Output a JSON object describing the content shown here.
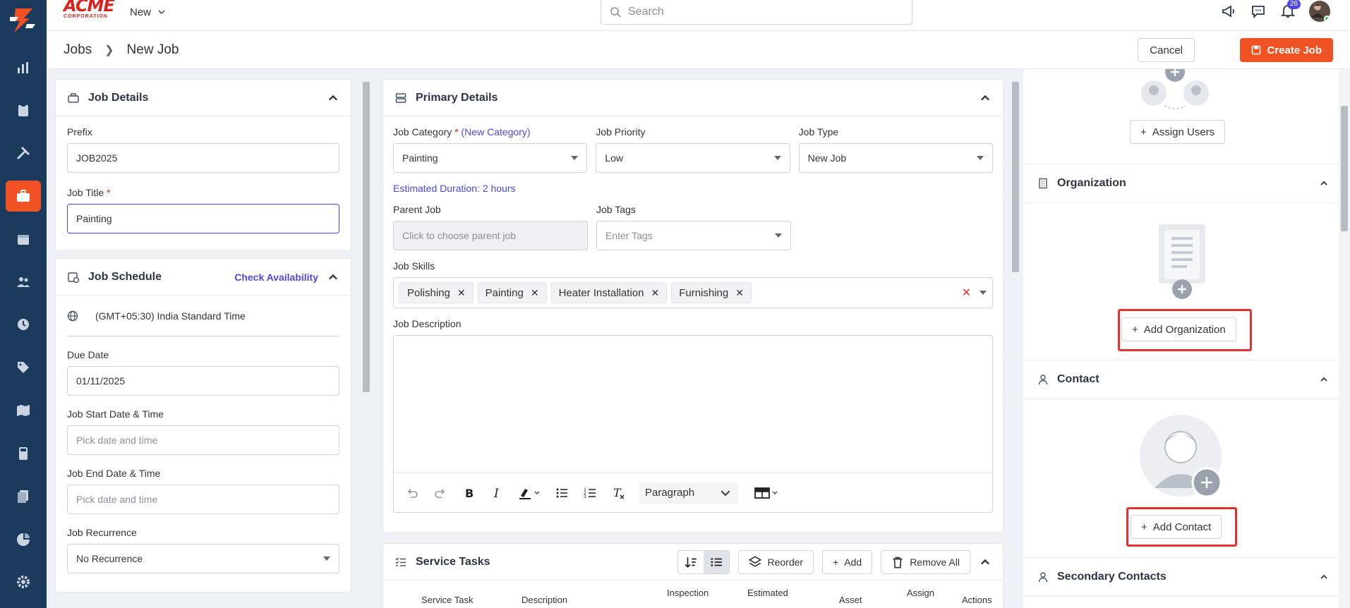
{
  "brand": {
    "name": "ACME",
    "sub": "CORPORATION"
  },
  "header": {
    "new_label": "New",
    "search_placeholder": "Search",
    "notification_count": "26"
  },
  "breadcrumb": {
    "root": "Jobs",
    "current": "New Job"
  },
  "actions": {
    "cancel": "Cancel",
    "create": "Create Job"
  },
  "job_details": {
    "title": "Job Details",
    "prefix_label": "Prefix",
    "prefix_value": "JOB2025",
    "job_title_label": "Job Title",
    "job_title_value": "Painting"
  },
  "job_schedule": {
    "title": "Job Schedule",
    "check_availability": "Check Availability",
    "timezone": "(GMT+05:30) India Standard Time",
    "due_date_label": "Due Date",
    "due_date_value": "01/11/2025",
    "start_label": "Job Start Date & Time",
    "start_placeholder": "Pick date and time",
    "end_label": "Job End Date & Time",
    "end_placeholder": "Pick date and time",
    "recurrence_label": "Job Recurrence",
    "recurrence_value": "No Recurrence"
  },
  "primary": {
    "title": "Primary Details",
    "category_label": "Job Category",
    "new_category": "(New Category)",
    "category_value": "Painting",
    "priority_label": "Job Priority",
    "priority_value": "Low",
    "type_label": "Job Type",
    "type_value": "New Job",
    "estimated": "Estimated Duration: 2 hours",
    "parent_label": "Parent Job",
    "parent_placeholder": "Click to choose parent job",
    "tags_label": "Job Tags",
    "tags_placeholder": "Enter Tags",
    "skills_label": "Job Skills",
    "skills": [
      "Polishing",
      "Painting",
      "Heater Installation",
      "Furnishing"
    ],
    "description_label": "Job Description",
    "paragraph": "Paragraph"
  },
  "service_tasks": {
    "title": "Service Tasks",
    "reorder": "Reorder",
    "add": "Add",
    "remove_all": "Remove All",
    "columns": [
      "Service Task",
      "Description",
      "Inspection",
      "Estimated",
      "Asset",
      "Assign",
      "Actions"
    ]
  },
  "right": {
    "assign_users": "Assign Users",
    "organization_title": "Organization",
    "add_organization": "Add Organization",
    "contact_title": "Contact",
    "add_contact": "Add Contact",
    "secondary_title": "Secondary Contacts"
  },
  "colors": {
    "accent": "#f05223",
    "rail": "#1c3a5c",
    "link": "#4f46e5",
    "highlight": "#e0322f"
  }
}
